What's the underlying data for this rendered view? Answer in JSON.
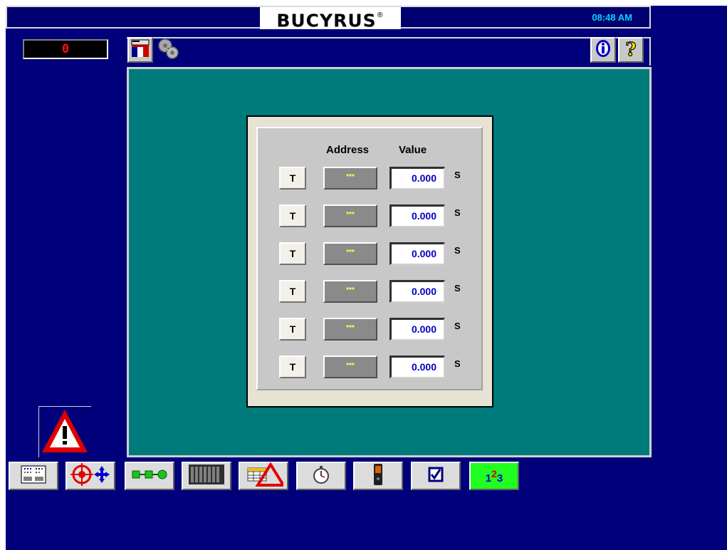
{
  "header": {
    "brand": "BUCYRUS",
    "brand_mark": "®",
    "clock": "08:48 AM"
  },
  "counter": {
    "value": "0"
  },
  "toolbar_top": [
    {
      "icon": "screen-flag-icon"
    },
    {
      "icon": "gears-icon"
    },
    {
      "icon": "info-icon"
    },
    {
      "icon": "help-icon"
    }
  ],
  "dialog": {
    "address_header": "Address",
    "value_header": "Value",
    "rows": [
      {
        "button": "T",
        "address": "***",
        "value": "0.000",
        "unit": "S"
      },
      {
        "button": "T",
        "address": "***",
        "value": "0.000",
        "unit": "S"
      },
      {
        "button": "T",
        "address": "***",
        "value": "0.000",
        "unit": "S"
      },
      {
        "button": "T",
        "address": "***",
        "value": "0.000",
        "unit": "S"
      },
      {
        "button": "T",
        "address": "***",
        "value": "0.000",
        "unit": "S"
      },
      {
        "button": "T",
        "address": "***",
        "value": "0.000",
        "unit": "S"
      }
    ]
  },
  "bottom_toolbar": {
    "items": [
      {
        "icon": "panel-layout-icon"
      },
      {
        "icon": "target-move-icon"
      },
      {
        "icon": "flow-diagram-icon"
      },
      {
        "icon": "rack-icon"
      },
      {
        "icon": "alarm-table-icon"
      },
      {
        "icon": "stopwatch-icon"
      },
      {
        "icon": "handheld-device-icon"
      },
      {
        "icon": "checkbox-icon"
      },
      {
        "icon": "counter-icon",
        "text_1": "1",
        "text_2": "2",
        "text_3": "3"
      }
    ]
  },
  "colors": {
    "background": "#00007b",
    "panel": "#007b7b",
    "clock": "#00d8ff",
    "counter_digits": "#ff1010",
    "value_text": "#0000c0",
    "address_text": "#ffff50",
    "active_button": "#20ff20"
  }
}
